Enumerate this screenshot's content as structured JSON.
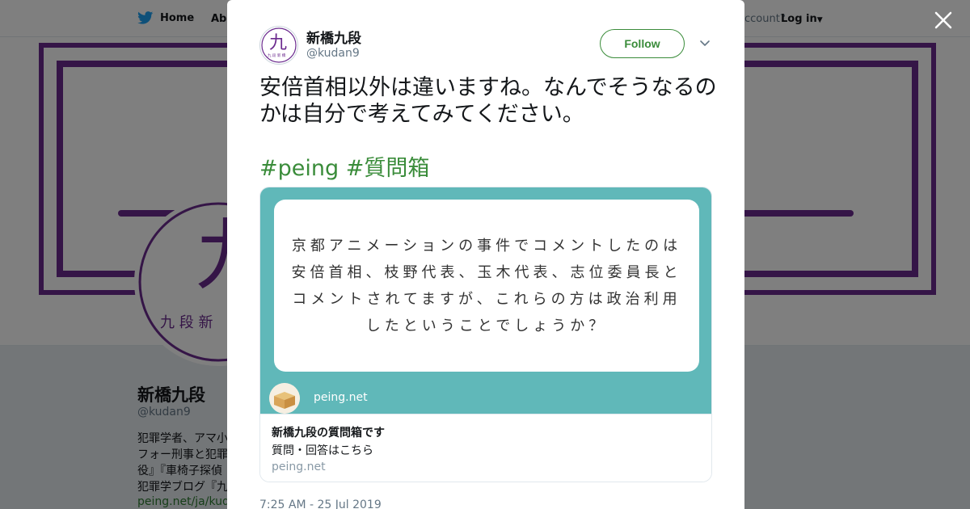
{
  "colors": {
    "accent_green": "#3a8c3a",
    "banner_purple": "#6b2a8e",
    "card_teal": "#60b8b9",
    "overlay": "rgba(0,0,0,0.5)"
  },
  "topbar": {
    "home_label": "Home",
    "about_label": "Abo",
    "account_prompt": "ccount?",
    "login_label": "Log in"
  },
  "banner": {
    "logo_glyph": "九",
    "logo_small_text": "九 段 新"
  },
  "profile": {
    "name": "新橋九段",
    "handle": "@kudan9",
    "bio_lines": [
      "犯罪学者、アマ小",
      "フォー刑事と犯罪",
      "役』『車椅子探偵",
      "犯罪学ブログ『九"
    ],
    "link": "peing.net/ja/kudan"
  },
  "modal": {
    "author_name": "新橋九段",
    "author_handle": "@kudan9",
    "avatar_glyph": "九",
    "avatar_small_text": "九 段 新 橋",
    "follow_label": "Follow",
    "tweet_text": "安倍首相以外は違いますね。なんでそうなるのかは自分で考えてみてください。",
    "hashtags": [
      "#peing",
      "#質問箱"
    ],
    "timestamp": "7:25 AM - 25 Jul 2019"
  },
  "card": {
    "question_lines": [
      "京都アニメーションの事件でコメントしたのは",
      "安倍首相、枝野代表、玉木代表、志位委員長と",
      "コメントされてますが、これらの方は政治利用",
      "したということでしょうか？"
    ],
    "image_site_name": "peing.net",
    "title": "新橋九段の質問箱です",
    "description": "質問・回答はこちら",
    "domain": "peing.net"
  },
  "icons": {
    "twitter": "twitter-bird-icon",
    "close": "close-icon",
    "caret": "chevron-down-icon",
    "peing_logo": "peing-box-logo"
  }
}
